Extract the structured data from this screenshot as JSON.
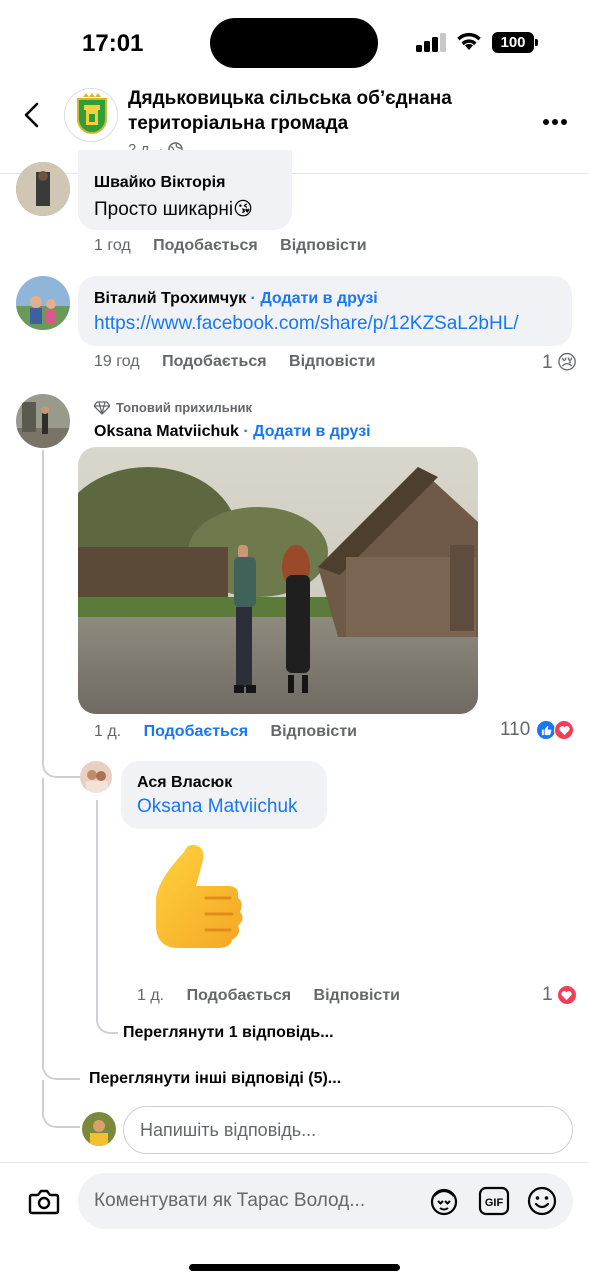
{
  "status_bar": {
    "time": "17:01",
    "battery": "100"
  },
  "header": {
    "page_name": "Дядьковицька сільська обʼєднана територіальна громада",
    "post_age": "2 д.",
    "separator": "·"
  },
  "comments": [
    {
      "author": "Швайко Вікторія",
      "text": "Просто шикарні",
      "emoji": "😘",
      "time": "1 год",
      "like_label": "Подобається",
      "reply_label": "Відповісти"
    },
    {
      "author": "Віталий Трохимчук",
      "add_friend": "· Додати в друзі",
      "text": "https://www.facebook.com/share/p/12KZSaL2bHL/",
      "time": "19 год",
      "like_label": "Подобається",
      "reply_label": "Відповісти",
      "reaction_count": "1",
      "reaction_emoji": "😢"
    },
    {
      "badge": "Топовий прихильник",
      "author": "Oksana Matviichuk",
      "add_friend": "· Додати в друзі",
      "time": "1 д.",
      "like_label": "Подобається",
      "reply_label": "Відповісти",
      "reaction_count": "110",
      "replies": [
        {
          "author": "Ася Власюк",
          "mention": "Oksana Matviichuk",
          "sticker": "👍",
          "time": "1 д.",
          "like_label": "Подобається",
          "reply_label": "Відповісти",
          "reaction_count": "1"
        }
      ],
      "view_one_reply": "Переглянути 1 відповідь...",
      "view_other_replies": "Переглянути інші відповіді (5)..."
    }
  ],
  "reply_input": {
    "placeholder": "Напишіть відповідь..."
  },
  "bottom_bar": {
    "placeholder": "Коментувати як Тарас Волод..."
  },
  "colors": {
    "link": "#1877f2",
    "bubble": "#f0f2f5",
    "muted": "#65676b",
    "love": "#f33e58"
  }
}
